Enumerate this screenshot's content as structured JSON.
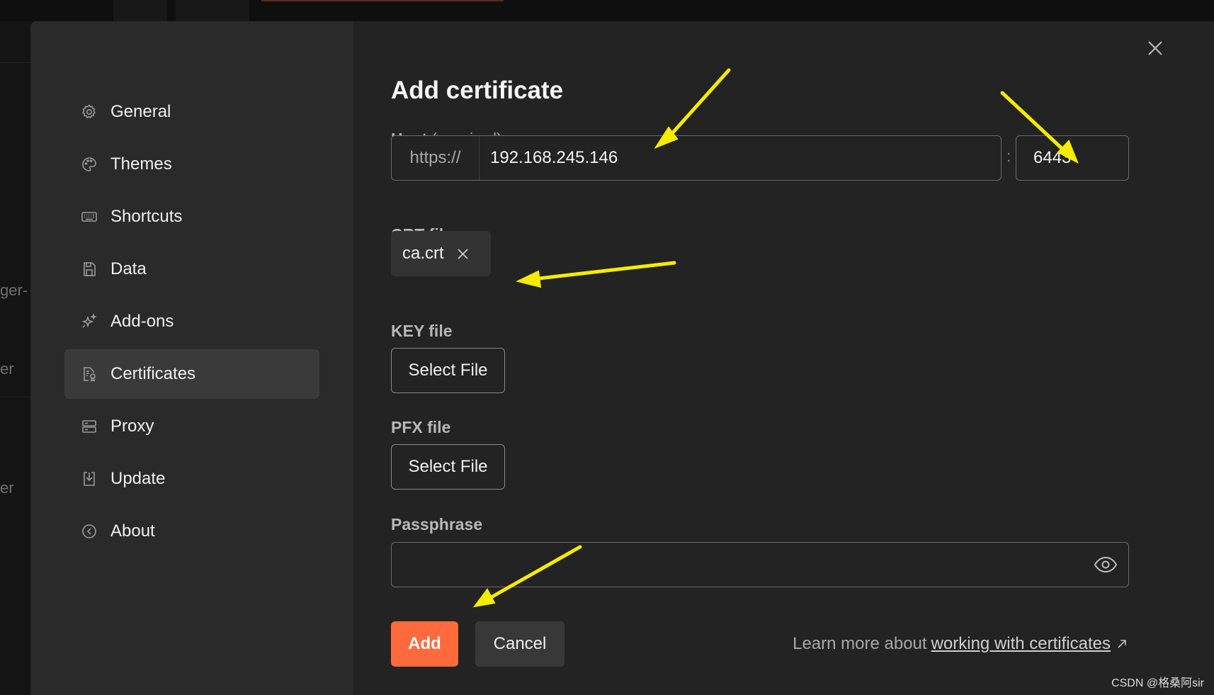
{
  "background": {
    "side_fragments": [
      "ger-",
      "er",
      "er"
    ]
  },
  "sidebar": {
    "items": [
      {
        "label": "General",
        "icon": "gear-icon"
      },
      {
        "label": "Themes",
        "icon": "palette-icon"
      },
      {
        "label": "Shortcuts",
        "icon": "keyboard-icon"
      },
      {
        "label": "Data",
        "icon": "floppy-disk-icon"
      },
      {
        "label": "Add-ons",
        "icon": "sparkle-icon"
      },
      {
        "label": "Certificates",
        "icon": "certificate-icon",
        "active": true
      },
      {
        "label": "Proxy",
        "icon": "server-icon"
      },
      {
        "label": "Update",
        "icon": "download-icon"
      },
      {
        "label": "About",
        "icon": "info-icon"
      }
    ]
  },
  "dialog": {
    "title": "Add certificate",
    "host": {
      "label": "Host",
      "hint": "(required)",
      "prefix": "https://",
      "value": "192.168.245.146",
      "separator": ":",
      "port": "6443"
    },
    "crt": {
      "label": "CRT file",
      "file_name": "ca.crt"
    },
    "key": {
      "label": "KEY file",
      "button": "Select File"
    },
    "pfx": {
      "label": "PFX file",
      "button": "Select File"
    },
    "passphrase": {
      "label": "Passphrase",
      "value": ""
    },
    "actions": {
      "add": "Add",
      "cancel": "Cancel"
    },
    "footer": {
      "prefix": "Learn more about",
      "link": "working with certificates"
    }
  },
  "watermark": "CSDN @格桑阿sir",
  "colors": {
    "accent": "#ff6a3c",
    "annotation_arrow": "#f5ec00",
    "modal_bg": "#232323",
    "sidebar_bg": "#2a2a2a"
  }
}
